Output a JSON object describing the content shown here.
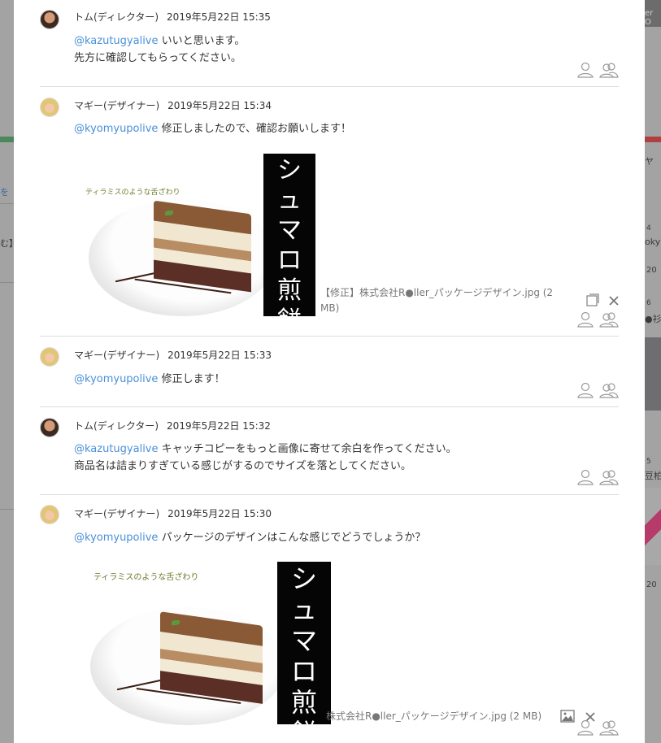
{
  "background": {
    "top_right_btn": "er O",
    "left_texts": [
      "を",
      "む】"
    ],
    "right_texts": [
      "ヤ",
      "4",
      "oky",
      "20",
      "6",
      "●衫",
      "5",
      "豆柏",
      "20"
    ]
  },
  "messages": [
    {
      "author": "トム(ディレクター)",
      "time": "2019年5月22日 15:35",
      "mention": "@kazutugyalive",
      "lines": [
        "いいと思います。",
        "先方に確認してもらってください。"
      ]
    },
    {
      "author": "マギー(デザイナー)",
      "time": "2019年5月22日 15:34",
      "mention": "@kyomyupolive",
      "lines": [
        "修正しましたので、確認お願いします！"
      ],
      "attachment": {
        "tagline": "ティラミスのような舌ざわり",
        "product_name": "シュマロ煎餅",
        "filename": "【修正】株式会社R●ller_パッケージデザイン.jpg (2",
        "filename2": "MB)"
      }
    },
    {
      "author": "マギー(デザイナー)",
      "time": "2019年5月22日 15:33",
      "mention": "@kyomyupolive",
      "lines": [
        "修正します！"
      ]
    },
    {
      "author": "トム(ディレクター)",
      "time": "2019年5月22日 15:32",
      "mention": "@kazutugyalive",
      "lines": [
        "キャッチコピーをもっと画像に寄せて余白を作ってください。",
        "商品名は詰まりすぎている感じがするのでサイズを落としてください。"
      ]
    },
    {
      "author": "マギー(デザイナー)",
      "time": "2019年5月22日 15:30",
      "mention": "@kyomyupolive",
      "lines": [
        "パッケージのデザインはこんな感じでどうでしょうか？"
      ],
      "attachment": {
        "tagline": "ティラミスのような舌ざわり",
        "product_name": "シュマロ煎餅",
        "filename": "株式会社R●ller_パッケージデザイン.jpg (2 MB)"
      }
    }
  ],
  "icons": {
    "read_single": "person-icon",
    "read_group": "group-icon",
    "copy": "copy-icon",
    "close": "close-icon",
    "image": "image-icon"
  }
}
